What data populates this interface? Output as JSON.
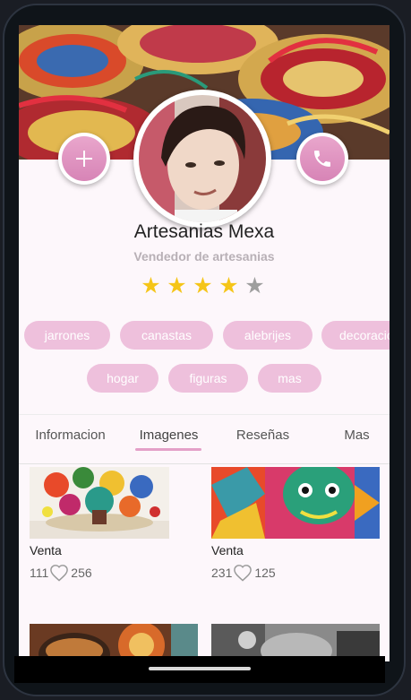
{
  "profile": {
    "name": "Artesanias Mexa",
    "subtitle": "Vendedor de artesanias",
    "rating": 4,
    "max_rating": 5
  },
  "actions": {
    "add_icon": "plus-icon",
    "call_icon": "phone-icon"
  },
  "tags": [
    "jarrones",
    "canastas",
    "alebrijes",
    "decoracion",
    "hogar",
    "figuras",
    "mas"
  ],
  "tabs": [
    "Informacion",
    "Imagenes",
    "Reseñas",
    "Mas"
  ],
  "active_tab": "Imagenes",
  "posts": [
    {
      "title": "Venta",
      "comments": "111",
      "likes": "256"
    },
    {
      "title": "Venta",
      "comments": "231",
      "likes": "125"
    }
  ],
  "colors": {
    "accent": "#e4a0c8",
    "chip": "#eec0dc",
    "star": "#f5c518",
    "star_empty": "#9e9e9e"
  }
}
